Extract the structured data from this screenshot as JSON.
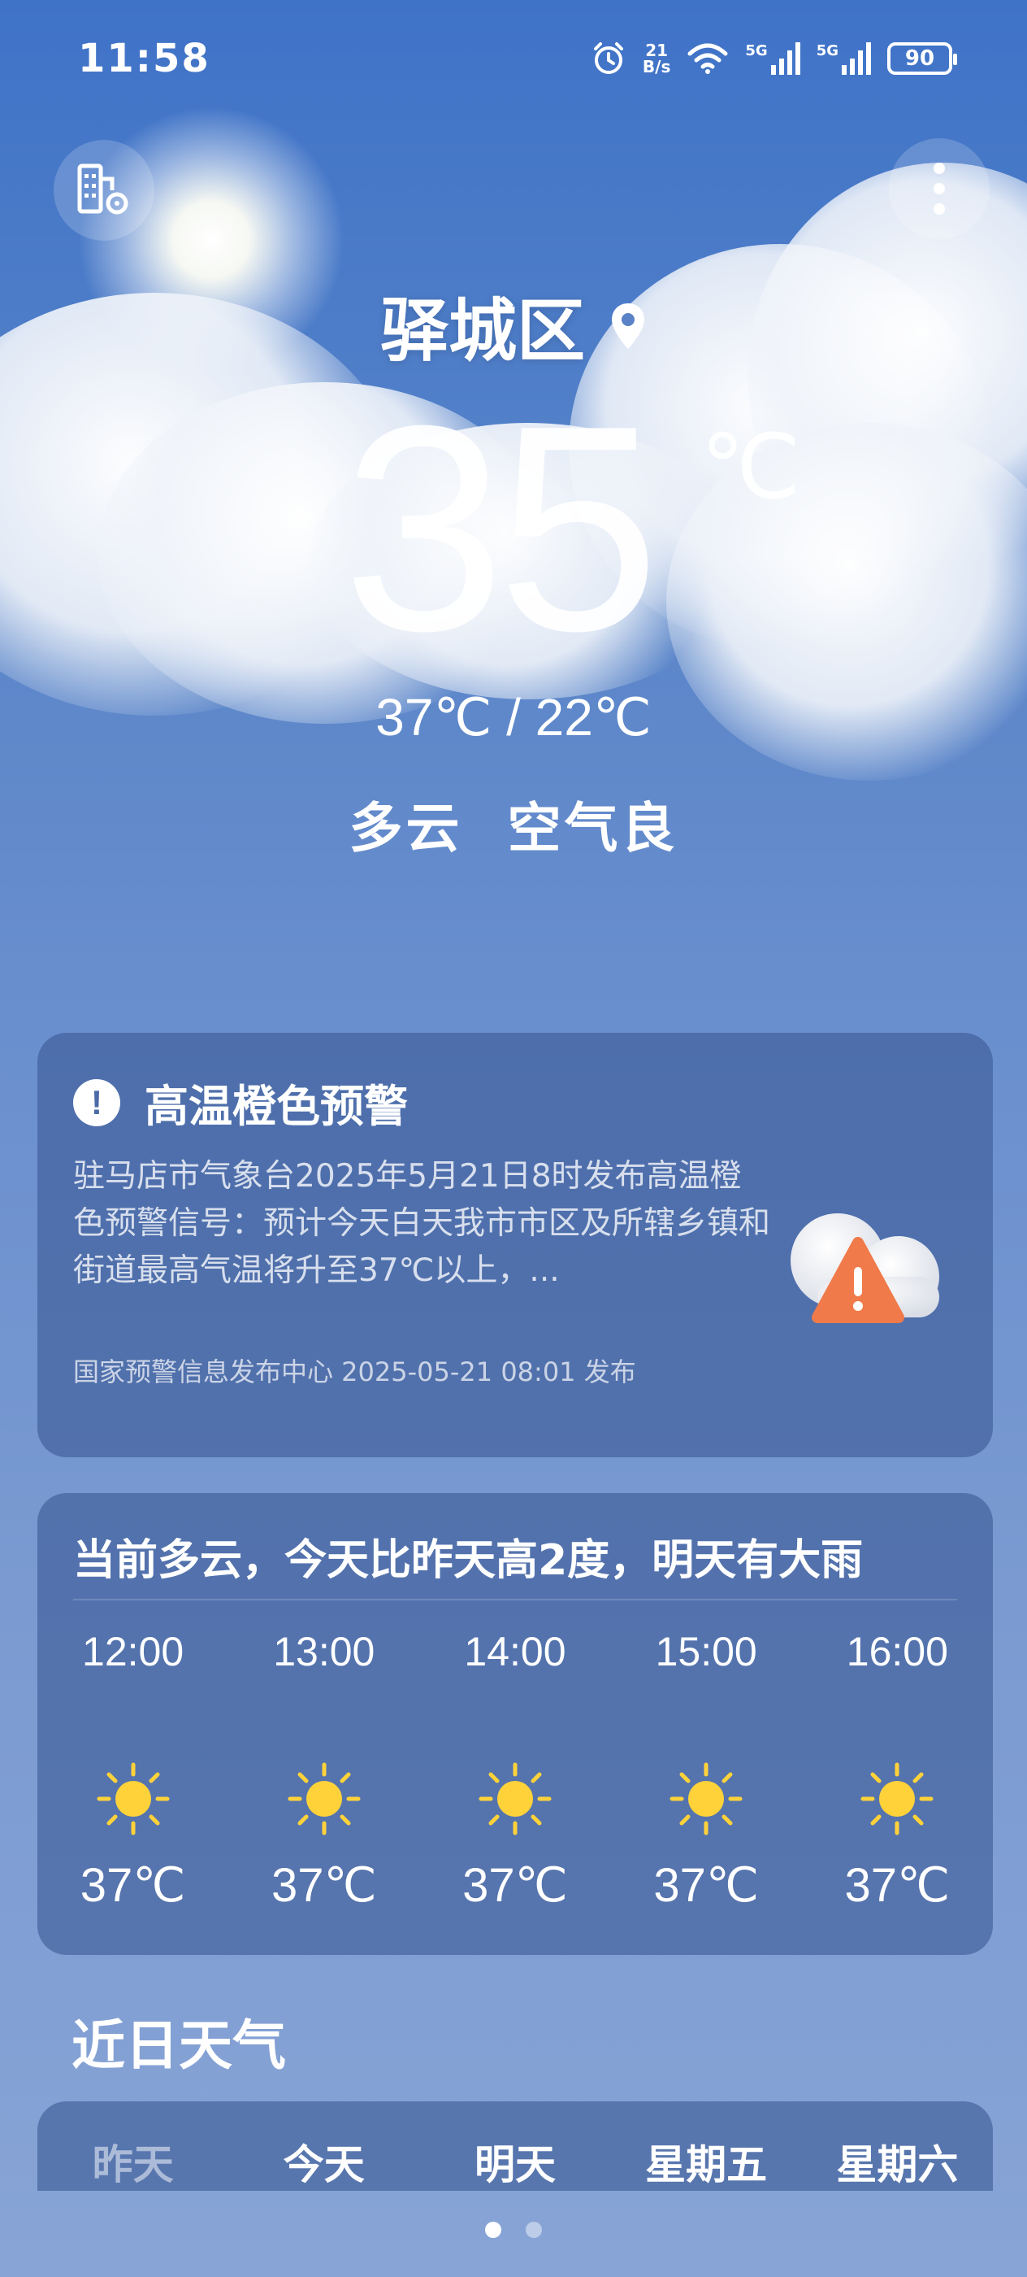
{
  "status_bar": {
    "time": "11:58",
    "net_speed_value": "21",
    "net_speed_unit": "B/s",
    "signal_1": "5G",
    "signal_2": "5G",
    "battery": "90"
  },
  "top_bar": {
    "left_icon": "city-manage-icon",
    "right_icon": "more-vert-icon"
  },
  "current": {
    "location": "驿城区",
    "location_icon": "location-pin-icon",
    "temperature": "35",
    "unit": "℃",
    "range": "37℃ / 22℃",
    "condition": "多云",
    "air_quality": "空气良"
  },
  "alert": {
    "title": "高温橙色预警",
    "body": "驻马店市气象台2025年5月21日8时发布高温橙色预警信号：预计今天白天我市市区及所辖乡镇和街道最高气温将升至37℃以上，...",
    "source": "国家预警信息发布中心 2025-05-21 08:01 发布",
    "icon": "warning-cloud-icon",
    "accent": "#f07a4a"
  },
  "hourly": {
    "summary": "当前多云，今天比昨天高2度，明天有大雨",
    "items": [
      {
        "time": "12:00",
        "icon": "sun-icon",
        "temp": "37℃"
      },
      {
        "time": "13:00",
        "icon": "sun-icon",
        "temp": "37℃"
      },
      {
        "time": "14:00",
        "icon": "sun-icon",
        "temp": "37℃"
      },
      {
        "time": "15:00",
        "icon": "sun-icon",
        "temp": "37℃"
      },
      {
        "time": "16:00",
        "icon": "sun-icon",
        "temp": "37℃"
      }
    ]
  },
  "daily": {
    "title": "近日天气",
    "days": [
      "昨天",
      "今天",
      "明天",
      "星期五",
      "星期六"
    ]
  },
  "page_indicator": {
    "count": 2,
    "active_index": 0
  }
}
